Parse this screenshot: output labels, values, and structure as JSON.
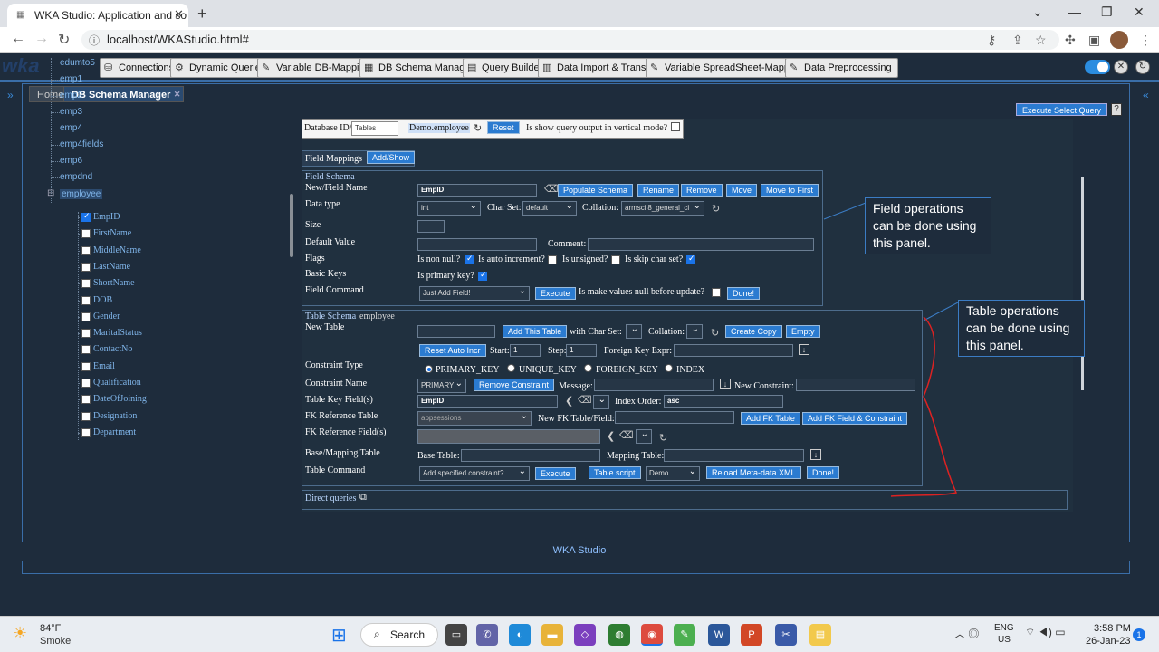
{
  "browser": {
    "tab_title": "WKA Studio: Application and so",
    "url": "localhost/WKAStudio.html#"
  },
  "app": {
    "logo": "wka",
    "top_menu": [
      "Connections",
      "Dynamic Queries",
      "Variable DB-Mapping",
      "DB Schema Manager",
      "Query Builder",
      "Data Import & Transfer",
      "Variable SpreadSheet-Mapping",
      "Data Preprocessing"
    ],
    "tabs": [
      "Home",
      "DB Schema Manager"
    ],
    "footer": "WKA Studio",
    "execute_select_query": "Execute Select Query",
    "help": "?"
  },
  "tree": {
    "tables": [
      "edumto5",
      "emp1",
      "emp2",
      "emp3",
      "emp4",
      "emp4fields",
      "emp6",
      "empdnd",
      "employee"
    ],
    "fields": [
      {
        "name": "EmpID",
        "checked": true
      },
      {
        "name": "FirstName",
        "checked": false
      },
      {
        "name": "MiddleName",
        "checked": false
      },
      {
        "name": "LastName",
        "checked": false
      },
      {
        "name": "ShortName",
        "checked": false
      },
      {
        "name": "DOB",
        "checked": false
      },
      {
        "name": "Gender",
        "checked": false
      },
      {
        "name": "MaritalStatus",
        "checked": false
      },
      {
        "name": "ContactNo",
        "checked": false
      },
      {
        "name": "Email",
        "checked": false
      },
      {
        "name": "Qualification",
        "checked": false
      },
      {
        "name": "DateOfJoining",
        "checked": false
      },
      {
        "name": "Designation",
        "checked": false
      },
      {
        "name": "Department",
        "checked": false
      }
    ]
  },
  "panel": {
    "database_id_label": "Database ID/",
    "database_id_value": "Tables",
    "database_name": "Demo.employee",
    "reset": "Reset",
    "vertical_label": "Is show query output in vertical mode?",
    "field_mappings": "Field Mappings",
    "add_show": "Add/Show",
    "field_schema": {
      "title": "Field Schema",
      "new_field_name": "New/Field Name",
      "field_value": "EmpID",
      "buttons": [
        "Populate Schema",
        "Rename",
        "Remove",
        "Move",
        "Move to First"
      ],
      "data_type": "Data type",
      "data_type_value": "int",
      "char_set": "Char Set:",
      "char_set_value": "default",
      "collation": "Collation:",
      "collation_value": "armscii8_general_ci",
      "size": "Size",
      "default_value": "Default Value",
      "comment": "Comment:",
      "flags": "Flags",
      "is_non_null": "Is non null?",
      "is_auto_increment": "Is auto increment?",
      "is_unsigned": "Is unsigned?",
      "is_skip_char_set": "Is skip char set?",
      "basic_keys": "Basic Keys",
      "is_primary_key": "Is primary key?",
      "field_command": "Field Command",
      "field_command_value": "Just Add Field!",
      "execute": "Execute",
      "make_null_label": "Is make values null before update?",
      "done": "Done!"
    },
    "table_schema": {
      "title": "Table Schema",
      "table_name": "employee",
      "new_table": "New Table",
      "add_this_table": "Add This Table",
      "with_char_set": "with Char Set:",
      "collation": "Collation:",
      "create_copy": "Create Copy",
      "empty": "Empty",
      "reset_auto_incr": "Reset Auto Incr",
      "start": "Start:",
      "start_value": "1",
      "step": "Step:",
      "step_value": "1",
      "fk_expr": "Foreign Key Expr:",
      "constraint_type": "Constraint Type",
      "constraint_types": [
        "PRIMARY_KEY",
        "UNIQUE_KEY",
        "FOREIGN_KEY",
        "INDEX"
      ],
      "constraint_name": "Constraint Name",
      "constraint_name_value": "PRIMARY",
      "remove_constraint": "Remove Constraint",
      "message": "Message:",
      "new_constraint": "New Constraint:",
      "table_key_fields": "Table Key Field(s)",
      "key_field_value": "EmpID",
      "index_order": "Index Order:",
      "index_order_value": "asc",
      "fk_reference_table": "FK Reference Table",
      "fk_ref_value": "appsessions",
      "new_fk_table_field": "New FK Table/Field:",
      "add_fk_table": "Add FK Table",
      "add_fk_field": "Add FK Field & Constraint",
      "fk_reference_fields": "FK Reference Field(s)",
      "base_mapping_table": "Base/Mapping Table",
      "base_table": "Base Table:",
      "mapping_table": "Mapping Table:",
      "table_command": "Table Command",
      "table_command_value": "Add specified constraint?",
      "execute": "Execute",
      "table_script": "Table script",
      "db_value": "Demo",
      "reload_meta": "Reload Meta-data XML",
      "done": "Done!"
    },
    "direct_queries": "Direct queries"
  },
  "callouts": {
    "field": "Field operations can be done using this panel.",
    "table": "Table operations can be done using this panel."
  },
  "taskbar": {
    "temp": "84°F",
    "weather": "Smoke",
    "search": "Search",
    "lang1": "ENG",
    "lang2": "US",
    "time": "3:58 PM",
    "date": "26-Jan-23",
    "notifications": "1"
  }
}
